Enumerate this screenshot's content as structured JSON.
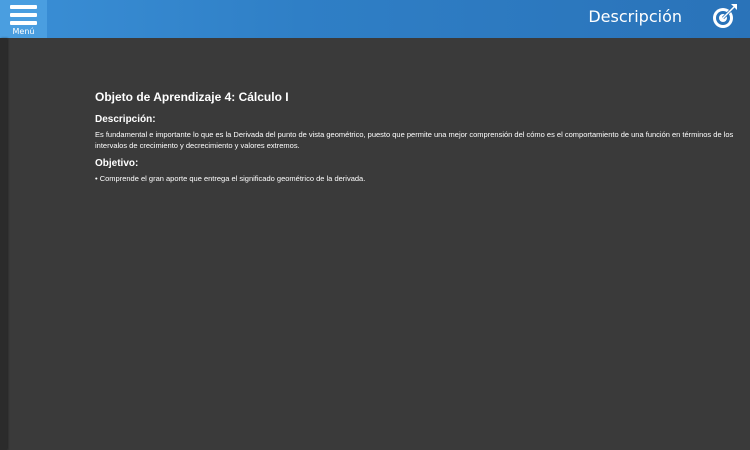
{
  "header": {
    "menu_label": "Menú",
    "title": "Descripción",
    "color_start": "#3a8fd6",
    "color_end": "#2a73b9"
  },
  "icons": {
    "menu": "hamburger-icon",
    "target": "target-arrow-icon"
  },
  "content": {
    "title": "Objeto de Aprendizaje 4: Cálculo I",
    "description_heading": "Descripción:",
    "description_text": "Es fundamental e importante lo que es la Derivada del punto de vista geométrico, puesto que permite una mejor comprensión del cómo es el comportamiento de una función en términos de los intervalos de crecimiento y decrecimiento y valores extremos.",
    "objective_heading": "Objetivo:",
    "objectives": [
      "• Comprende el gran aporte que entrega el significado geométrico de la derivada."
    ]
  },
  "colors": {
    "background": "#3a3a3a",
    "text": "#ffffff"
  }
}
